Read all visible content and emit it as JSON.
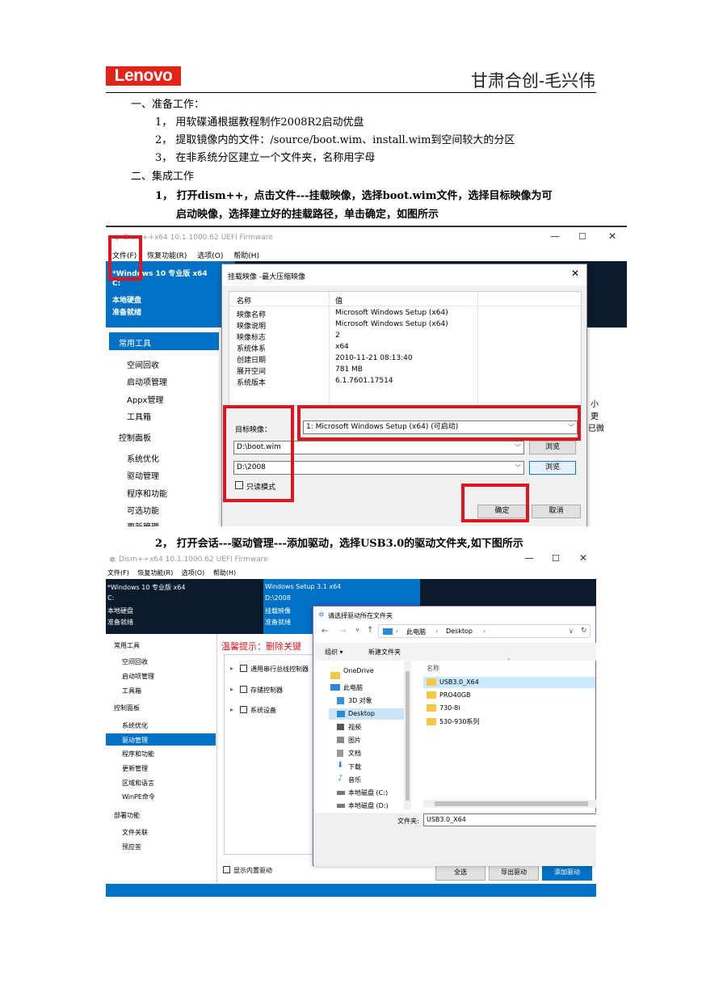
{
  "header": {
    "logo": "Lenovo",
    "title": "甘肃合创-毛兴伟"
  },
  "doc": {
    "s1": "一、准备工作：",
    "s1_1": "1，  用软碟通根据教程制作2008R2启动优盘",
    "s1_2": "2，  提取镜像内的文件：/source/boot.wim、install.wim到空间较大的分区",
    "s1_3": "3，  在非系统分区建立一个文件夹，名称用字母",
    "s2": "二、集成工作",
    "s2_1a": "1， 打开dism++，点击文件---挂载映像，选择boot.wim文件，选择目标映像为可",
    "s2_1b": "启动映像，选择建立好的挂载路径，单击确定，如图所示",
    "s2_2": "2， 打开会话---驱动管理---添加驱动，选择USB3.0的驱动文件夹,如下图所示"
  },
  "shot1": {
    "title": "Dism++x64 10.1.1000.62 UEFI Firmware",
    "menu": [
      "文件(F)",
      "恢复功能(R)",
      "选项(O)",
      "帮助(H)"
    ],
    "session": [
      "*Windows 10 专业版 x64",
      "C:",
      "本地硬盘",
      "准备就绪"
    ],
    "sidebar_head1": "常用工具",
    "sidebar_items1": [
      "空间回收",
      "启动项管理",
      "Appx管理",
      "工具箱"
    ],
    "sidebar_head2": "控制面板",
    "sidebar_items2": [
      "系统优化",
      "驱动管理",
      "程序和功能",
      "可选功能",
      "更新管理"
    ],
    "right_text": [
      "小",
      "更",
      "已微"
    ],
    "dialog": {
      "title": "挂载映像 -最大压缩映像",
      "col_name": "名称",
      "col_value": "值",
      "rows": [
        [
          "映像名称",
          "Microsoft Windows Setup (x64)"
        ],
        [
          "映像说明",
          "Microsoft Windows Setup (x64)"
        ],
        [
          "映像标志",
          "2"
        ],
        [
          "系统体系",
          "x64"
        ],
        [
          "创建日期",
          "2010-11-21 08:13:40"
        ],
        [
          "展开空间",
          "781 MB"
        ],
        [
          "系统版本",
          "6.1.7601.17514"
        ]
      ],
      "target_label": "目标映像：",
      "target_value": "1: Microsoft Windows Setup (x64) (可启动)",
      "wim_path": "D:\\boot.wim",
      "mount_path": "D:\\2008",
      "browse": "浏览",
      "readonly": "只读模式",
      "ok": "确定",
      "cancel": "取消"
    }
  },
  "shot2": {
    "title": "Dism++x64 10.1.1000.62 UEFI Firmware",
    "menu": [
      "文件(F)",
      "恢复功能(R)",
      "选项(O)",
      "帮助(H)"
    ],
    "session1": [
      "*Windows 10 专业版 x64",
      "C:",
      "本地硬盘",
      "准备就绪"
    ],
    "session2": [
      "Windows Setup 3.1 x64",
      "D:\\2008",
      "挂载映像",
      "准备就绪"
    ],
    "sidebar_head1": "常用工具",
    "sidebar_items1": [
      "空间回收",
      "启动项管理",
      "工具箱"
    ],
    "sidebar_head2": "控制面板",
    "sidebar_items2": [
      "系统优化",
      "驱动管理",
      "程序和功能",
      "更新管理",
      "区域和语言",
      "WinPE命令"
    ],
    "sidebar_head3": "部署功能",
    "sidebar_items3": [
      "文件关联",
      "预应答"
    ],
    "warning": "温馨提示：删除关键",
    "tree": [
      "通用串行总线控制器",
      "存储控制器",
      "系统设备"
    ],
    "show_builtin": "显示内置驱动",
    "btn_all": "全选",
    "btn_export": "导出驱动",
    "btn_add": "添加驱动",
    "picker": {
      "title": "请选择驱动所在文件夹",
      "path": [
        "此电脑",
        "Desktop"
      ],
      "organize": "组织 ▾",
      "new_folder": "新建文件夹",
      "nav": [
        "OneDrive",
        "此电脑",
        "3D 对象",
        "Desktop",
        "视频",
        "图片",
        "文档",
        "下载",
        "音乐",
        "本地磁盘 (C:)",
        "本地磁盘 (D:)"
      ],
      "col_name": "名称",
      "files": [
        "USB3.0_X64",
        "PRO40GB",
        "730-8i",
        "530-930系列"
      ],
      "folder_label": "文件夹:",
      "folder_value": "USB3.0_X64"
    }
  }
}
